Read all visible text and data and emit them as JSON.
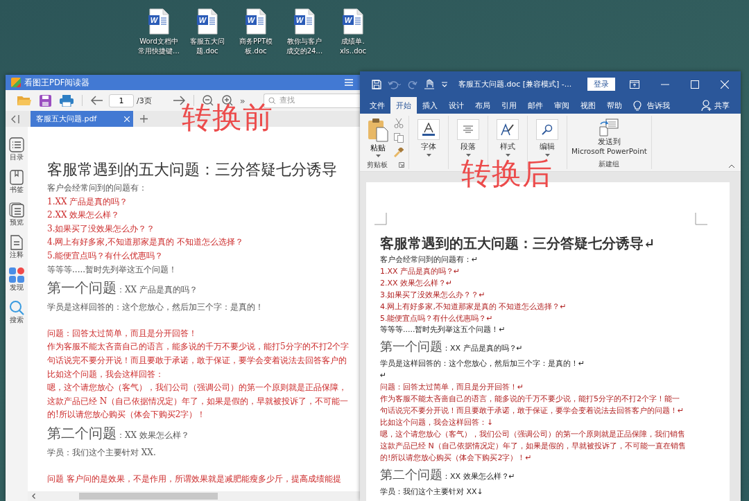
{
  "desktop_icons": [
    {
      "icon_letter": "W",
      "lines": [
        "Word文档中",
        "常用快捷键…"
      ]
    },
    {
      "icon_letter": "W",
      "lines": [
        "客服五大问",
        "题.doc"
      ]
    },
    {
      "icon_letter": "W",
      "lines": [
        "商务PPT模",
        "板.doc"
      ]
    },
    {
      "icon_letter": "W",
      "lines": [
        "教你与客户",
        "成交的24…"
      ]
    },
    {
      "icon_letter": "W",
      "lines": [
        "成绩单.",
        "xls..doc"
      ]
    }
  ],
  "pdf_reader": {
    "title": "看图王PDF阅读器",
    "page": "1",
    "page_total": "/3页",
    "search_placeholder": "查找",
    "more": "»",
    "tabs": [
      {
        "label": "客服五大问题.pdf",
        "selected": true
      }
    ],
    "sidebar": [
      {
        "label": "目录"
      },
      {
        "label": "书签"
      },
      {
        "label": "预览"
      },
      {
        "label": "注释"
      },
      {
        "label": "发现"
      },
      {
        "label": "搜索"
      }
    ],
    "annotation": "转换前",
    "lines": [
      {
        "kind": "title",
        "text": "客服常遇到的五大问题：三分答疑七分诱导"
      },
      {
        "kind": "text",
        "text": "客户会经常问到的问题有："
      },
      {
        "kind": "red",
        "text": "1.XX 产品是真的吗？"
      },
      {
        "kind": "red",
        "text": "2.XX 效果怎么样？"
      },
      {
        "kind": "red",
        "text": "3.如果买了没效果怎么办？？"
      },
      {
        "kind": "red",
        "text": "4.网上有好多家,不知道那家是真的  不知道怎么选择？"
      },
      {
        "kind": "red",
        "text": "5.能便宜点吗？有什么优惠吗？"
      },
      {
        "kind": "text",
        "text": "等等等.....暂时先列举这五个问题！"
      },
      {
        "kind": "heading",
        "text": "第一个问题",
        "sub": "：XX 产品是真的吗？"
      },
      {
        "kind": "text",
        "text": "学员是这样回答的：这个您放心，然后加三个字：是真的！"
      },
      {
        "kind": "spacer"
      },
      {
        "kind": "red",
        "text": "问题：回答太过简单，而且是分开回答！"
      },
      {
        "kind": "red",
        "text": "作为客服不能太吝啬自己的语言，能多说的千万不要少说，能打5分字的不打2个字"
      },
      {
        "kind": "red",
        "text": "句话说完不要分开说！而且要敢于承诺，敢于保证，要学会变着说法去回答客户的"
      },
      {
        "kind": "red",
        "text": "比如这个问题，我会这样回答："
      },
      {
        "kind": "red",
        "text": "嗯，这个请您放心（客气），我们公司（强调公司）的第一个原则就是正品保障，"
      },
      {
        "kind": "red",
        "text": "这款产品已经 N（自己依据情况定）年了，如果是假的，早就被投诉了，不可能一"
      },
      {
        "kind": "red",
        "text": "的!所以请您放心购买（体会下购买2字）！"
      },
      {
        "kind": "heading",
        "text": "第二个问题",
        "sub": "：XX 效果怎么样？"
      },
      {
        "kind": "text",
        "text": "学员：我们这个主要针对 XX."
      },
      {
        "kind": "spacer"
      },
      {
        "kind": "red",
        "text": "问题 客户问的是效果，不是作用，所谓效果就是减肥能瘦多少斤，提高成绩能提"
      }
    ]
  },
  "word": {
    "title": "客服五大问题.doc [兼容模式]  -...",
    "login": "登录",
    "tabs": [
      {
        "label": "文件",
        "selected": false
      },
      {
        "label": "开始",
        "selected": true
      },
      {
        "label": "插入",
        "selected": false
      },
      {
        "label": "设计",
        "selected": false
      },
      {
        "label": "布局",
        "selected": false
      },
      {
        "label": "引用",
        "selected": false
      },
      {
        "label": "邮件",
        "selected": false
      },
      {
        "label": "审阅",
        "selected": false
      },
      {
        "label": "视图",
        "selected": false
      },
      {
        "label": "帮助",
        "selected": false
      }
    ],
    "tell_me": "告诉我",
    "share": "共享",
    "ribbon": {
      "paste": "粘贴",
      "clipboard": "剪贴板",
      "buttons": [
        {
          "label": "字体"
        },
        {
          "label": "段落"
        },
        {
          "label": "样式"
        },
        {
          "label": "编辑"
        }
      ],
      "send": "发送到",
      "send_target": "Microsoft PowerPoint",
      "group": "新建组"
    },
    "annotation": "转换后",
    "lines": [
      {
        "kind": "title",
        "text": "客服常遇到的五大问题：三分答疑七分诱导↵"
      },
      {
        "kind": "text",
        "text": "客户会经常问到的问题有：↵"
      },
      {
        "kind": "red",
        "text": "1.XX 产品是真的吗？↵"
      },
      {
        "kind": "red",
        "text": "2.XX 效果怎么样？↵"
      },
      {
        "kind": "red",
        "text": "3.如果买了没效果怎么办？？↵"
      },
      {
        "kind": "red",
        "text": "4.网上有好多家,不知道那家是真的  不知道怎么选择？↵"
      },
      {
        "kind": "red",
        "text": "5.能便宜点吗？有什么优惠吗？↵"
      },
      {
        "kind": "text",
        "text": "等等等.....暂时先列举这五个问题！↵"
      },
      {
        "kind": "heading",
        "text": "第一个问题",
        "sub": "：XX 产品是真的吗？↵"
      },
      {
        "kind": "text",
        "text": "学员是这样回答的：这个您放心，然后加三个字：是真的！↵"
      },
      {
        "kind": "text",
        "text": "↵"
      },
      {
        "kind": "red",
        "text": "问题：回答太过简单，而且是分开回答！↵"
      },
      {
        "kind": "red",
        "text": "作为客服不能太吝啬自己的语言，能多说的千万不要少说，能打5分字的不打2个字！能一"
      },
      {
        "kind": "red",
        "text": "句话说完不要分开说！而且要敢于承诺，敢于保证，要学会变着说法去回答客户的问题！↵"
      },
      {
        "kind": "red",
        "text": "比如这个问题，我会这样回答：↓"
      },
      {
        "kind": "red",
        "text": "嗯，这个请您放心（客气），我们公司（强调公司）的第一个原则就是正品保障，我们销售"
      },
      {
        "kind": "red",
        "text": "这款产品已经 N（自己依据情况定）年了，如果是假的，早就被投诉了，不可能一直在销售"
      },
      {
        "kind": "red",
        "text": "的!所以请您放心购买（体会下购买2字）！↵"
      },
      {
        "kind": "heading",
        "text": "第二个问题",
        "sub": "：XX 效果怎么样？↵"
      },
      {
        "kind": "text",
        "text": "学员：我们这个主要针对 XX↓"
      }
    ]
  }
}
